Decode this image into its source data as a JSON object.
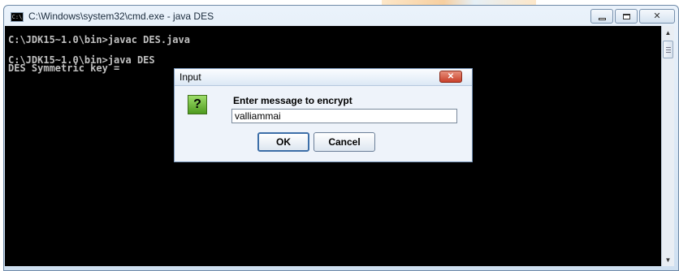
{
  "window": {
    "title": "C:\\Windows\\system32\\cmd.exe - java  DES",
    "icon": "cmd-icon",
    "controls": {
      "minimize": "minimize-icon",
      "maximize": "maximize-icon",
      "close": "close-icon"
    }
  },
  "console": {
    "lines": [
      "C:\\JDK15~1.0\\bin>javac DES.java",
      "C:\\JDK15~1.0\\bin>java DES",
      "DES Symmetric key = "
    ]
  },
  "dialog": {
    "title": "Input",
    "icon": "question-icon",
    "icon_glyph": "?",
    "prompt": "Enter message to encrypt",
    "input_value": "valliammai",
    "ok_label": "OK",
    "cancel_label": "Cancel",
    "close_glyph": "✕"
  },
  "scrollbar": {
    "up_glyph": "▲",
    "down_glyph": "▼"
  }
}
